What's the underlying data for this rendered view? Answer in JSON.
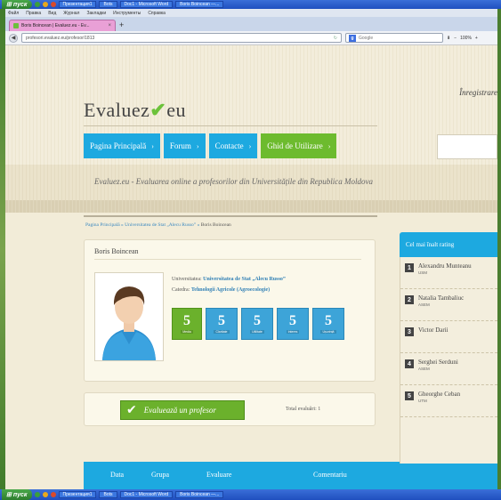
{
  "taskbar_top": {
    "start": "пуск",
    "items": [
      "Презентация1",
      "Bots",
      "Doc1 - Microsoft Word",
      "Boris Boincean —..."
    ]
  },
  "browser": {
    "menu": [
      "Файл",
      "Правка",
      "Вид",
      "Журнал",
      "Закладки",
      "Инструменты",
      "Справка"
    ],
    "tab_title": "Boris Boincean | Evaluez.eu - Ev...",
    "new_tab": "+",
    "url": "profesori.evaluez.eu/profesor/1813",
    "search_placeholder": "Google",
    "zoom": "100%"
  },
  "site": {
    "register": "Înregistrare",
    "logo_left": "Evaluez",
    "logo_check": "✔",
    "logo_right": "eu",
    "nav": [
      {
        "label": "Pagina Principală",
        "arrow": "›"
      },
      {
        "label": "Forum",
        "arrow": "›"
      },
      {
        "label": "Contacte",
        "arrow": "›"
      },
      {
        "label": "Ghid de Utilizare",
        "arrow": "›"
      }
    ],
    "tagline": "Evaluez.eu - Evaluarea online a profesorilor din Universitățile din Republica Moldova"
  },
  "breadcrumb": {
    "home": "Pagina Principală",
    "sep1": " » ",
    "uni": "Universitatea de Stat „Alecu Russo”",
    "sep2": " » ",
    "current": "Boris Boincean"
  },
  "profile": {
    "name": "Boris Boincean",
    "university_label": "Universitatea:",
    "university": "Universitatea de Stat „Alecu Russo”",
    "department_label": "Catedra:",
    "department": "Tehnologii Agricole (Agroecologie)",
    "scores": [
      {
        "value": "5",
        "label": "Media"
      },
      {
        "value": "5",
        "label": "Claritate"
      },
      {
        "value": "5",
        "label": "Utilitate"
      },
      {
        "value": "5",
        "label": "Interes"
      },
      {
        "value": "5",
        "label": "Ușurință"
      }
    ]
  },
  "evaluate": {
    "button": "Evaluează un profesor",
    "total_label": "Total evaluări:",
    "total": "1"
  },
  "table": {
    "columns": [
      "Data",
      "Grupa",
      "Evaluare",
      "Comentariu"
    ]
  },
  "sidebar": {
    "title": "Cel mai înalt rating",
    "items": [
      {
        "rank": "1",
        "name": "Alexandru Munteanu",
        "uni": "USM"
      },
      {
        "rank": "2",
        "name": "Natalia Tambaliuc",
        "uni": "ASEM"
      },
      {
        "rank": "3",
        "name": "Victor Darii",
        "uni": ""
      },
      {
        "rank": "4",
        "name": "Serghei Serduni",
        "uni": "ASEM"
      },
      {
        "rank": "5",
        "name": "Gheorghe Ceban",
        "uni": "UTM"
      }
    ]
  },
  "colors": {
    "blue": "#1da9e0",
    "green": "#6bb12c",
    "background": "#f2ecd8"
  }
}
